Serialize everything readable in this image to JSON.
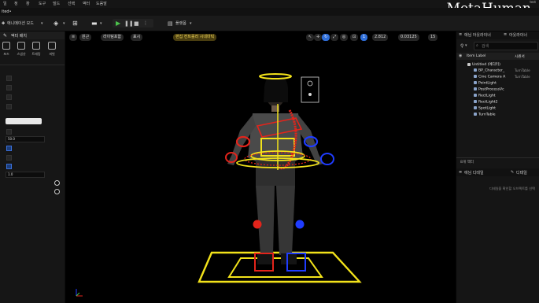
{
  "menubar": {
    "items": [
      "일",
      "정",
      "창",
      "도구",
      "빌드",
      "선택",
      "액터",
      "도움말"
    ],
    "brand": "MetaHuman",
    "brand_sup": "test"
  },
  "tab": {
    "title": "ited•"
  },
  "toolbar": {
    "mode_label": "애니메이션 모드",
    "platform_label": "플랫폼"
  },
  "left_panel": {
    "title": "액터 배치",
    "modes": [
      "포즈",
      "스냅샷",
      "트래킹",
      "피벗"
    ],
    "field_value_1": "50.0",
    "field_value_2": "1.0"
  },
  "viewport": {
    "perspective_label": "원근",
    "lighting_label": "라이팅포함",
    "show_label": "표시",
    "anim_mode_label": "편집 컨트롤러 시네마틱",
    "grid_value": "1",
    "snap_angle": "2.812",
    "scale_value": "0.03125",
    "camera_speed": "15"
  },
  "right_panel": {
    "tab_animation_outliner": "애님 아웃라이너",
    "tab_outliner": "아웃라이너",
    "search_placeholder": "검색",
    "col_item_label": "Item Label",
    "col_type": "시퀀서",
    "rows": [
      {
        "label": "Untitled (에디터)",
        "type": ""
      },
      {
        "label": "BP_Character_",
        "type": "TurnTable"
      },
      {
        "label": "Cine Camera A",
        "type": "TurnTable"
      },
      {
        "label": "PointLight",
        "type": ""
      },
      {
        "label": "PostProcessVc",
        "type": ""
      },
      {
        "label": "RectLight",
        "type": ""
      },
      {
        "label": "RectLight2",
        "type": ""
      },
      {
        "label": "SpotLight",
        "type": ""
      },
      {
        "label": "TurnTable",
        "type": ""
      }
    ],
    "actor_count": "8개 액터",
    "details_tab_anim": "애님 디테일",
    "details_tab": "디테일",
    "details_empty": "디테일을 확인할 오브젝트를 선택"
  },
  "colors": {
    "accent": "#2f6ed8",
    "rig_yellow": "#f2e21a",
    "rig_red": "#e3241b",
    "rig_blue": "#1f3cff",
    "play_green": "#4cc24c"
  }
}
